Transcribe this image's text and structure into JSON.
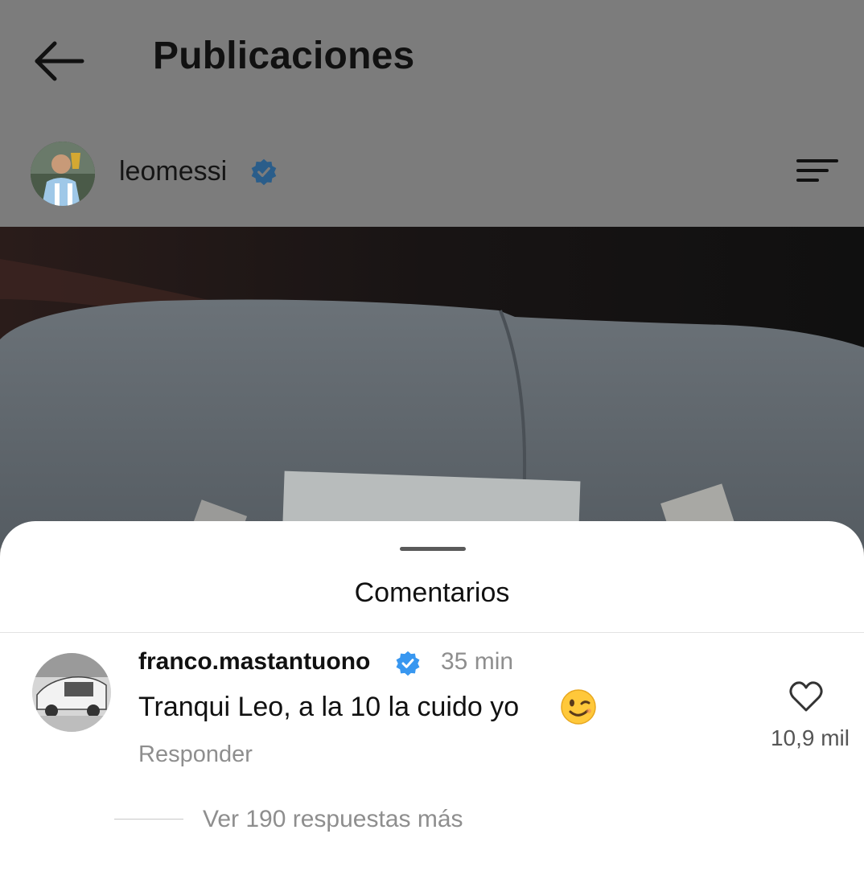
{
  "header": {
    "title": "Publicaciones"
  },
  "post": {
    "author": "leomessi",
    "verified": true
  },
  "comments_sheet": {
    "title": "Comentarios",
    "comment": {
      "username": "franco.mastantuono",
      "verified": true,
      "time": "35 min",
      "text": "Tranqui Leo, a la 10 la cuido yo",
      "emoji": "wink-emoji",
      "reply_label": "Responder",
      "like_count": "10,9 mil"
    },
    "view_more_replies": "Ver 190 respuestas más"
  },
  "colors": {
    "verified_blue": "#3897f0",
    "muted_text": "#8e8e8e",
    "dim_overlay": "#7c7c7c"
  }
}
